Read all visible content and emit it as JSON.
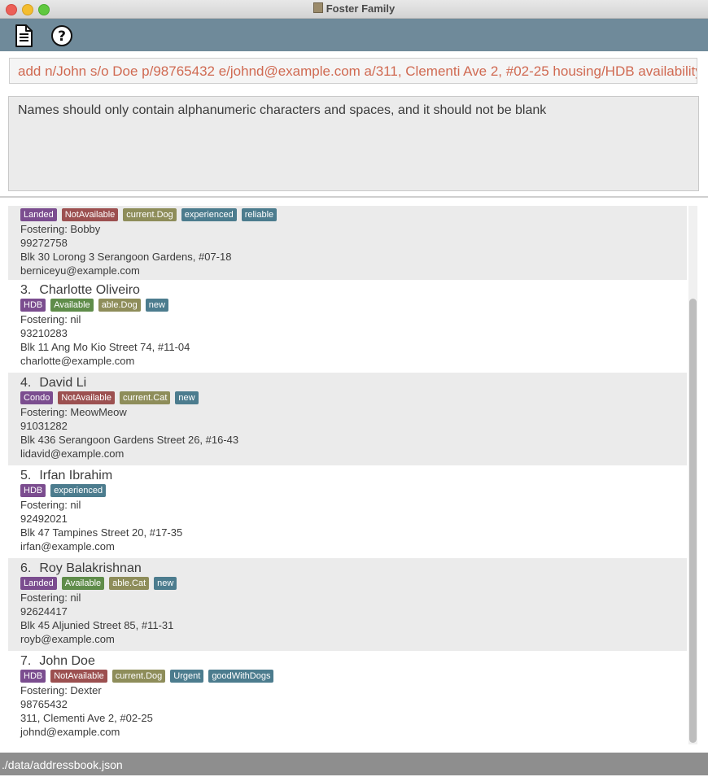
{
  "window": {
    "title": "Foster Family"
  },
  "toolbar": {
    "file_icon": "document-icon",
    "help_icon": "help-icon"
  },
  "command": {
    "value": "add n/John s/o Doe p/98765432 e/johnd@example.com a/311, Clementi Ave 2, #02-25 housing/HDB availability/N"
  },
  "result": {
    "message": "Names should only contain alphanumeric characters and spaces, and it should not be blank"
  },
  "persons": [
    {
      "index": "",
      "name": "",
      "tags": [
        {
          "label": "Landed",
          "kind": "housing"
        },
        {
          "label": "NotAvailable",
          "kind": "notavail"
        },
        {
          "label": "current.Dog",
          "kind": "animal"
        },
        {
          "label": "experienced",
          "kind": "misc"
        },
        {
          "label": "reliable",
          "kind": "misc"
        }
      ],
      "fostering": "Fostering: Bobby",
      "phone": "99272758",
      "address": "Blk 30 Lorong 3 Serangoon Gardens, #07-18",
      "email": "berniceyu@example.com"
    },
    {
      "index": "3.",
      "name": "Charlotte Oliveiro",
      "tags": [
        {
          "label": "HDB",
          "kind": "housing"
        },
        {
          "label": "Available",
          "kind": "avail"
        },
        {
          "label": "able.Dog",
          "kind": "animal"
        },
        {
          "label": "new",
          "kind": "misc"
        }
      ],
      "fostering": "Fostering: nil",
      "phone": "93210283",
      "address": "Blk 11 Ang Mo Kio Street 74, #11-04",
      "email": "charlotte@example.com"
    },
    {
      "index": "4.",
      "name": "David Li",
      "tags": [
        {
          "label": "Condo",
          "kind": "housing"
        },
        {
          "label": "NotAvailable",
          "kind": "notavail"
        },
        {
          "label": "current.Cat",
          "kind": "animal"
        },
        {
          "label": "new",
          "kind": "misc"
        }
      ],
      "fostering": "Fostering: MeowMeow",
      "phone": "91031282",
      "address": "Blk 436 Serangoon Gardens Street 26, #16-43",
      "email": "lidavid@example.com"
    },
    {
      "index": "5.",
      "name": "Irfan Ibrahim",
      "tags": [
        {
          "label": "HDB",
          "kind": "housing"
        },
        {
          "label": "experienced",
          "kind": "misc"
        }
      ],
      "fostering": "Fostering: nil",
      "phone": "92492021",
      "address": "Blk 47 Tampines Street 20, #17-35",
      "email": "irfan@example.com"
    },
    {
      "index": "6.",
      "name": "Roy Balakrishnan",
      "tags": [
        {
          "label": "Landed",
          "kind": "housing"
        },
        {
          "label": "Available",
          "kind": "avail"
        },
        {
          "label": "able.Cat",
          "kind": "animal"
        },
        {
          "label": "new",
          "kind": "misc"
        }
      ],
      "fostering": "Fostering: nil",
      "phone": "92624417",
      "address": "Blk 45 Aljunied Street 85, #11-31",
      "email": "royb@example.com"
    },
    {
      "index": "7.",
      "name": "John Doe",
      "tags": [
        {
          "label": "HDB",
          "kind": "housing"
        },
        {
          "label": "NotAvailable",
          "kind": "notavail"
        },
        {
          "label": "current.Dog",
          "kind": "animal"
        },
        {
          "label": "Urgent",
          "kind": "misc"
        },
        {
          "label": "goodWithDogs",
          "kind": "misc"
        }
      ],
      "fostering": "Fostering: Dexter",
      "phone": "98765432",
      "address": "311, Clementi Ave 2, #02-25",
      "email": "johnd@example.com"
    }
  ],
  "status": {
    "path": "./data/addressbook.json"
  }
}
